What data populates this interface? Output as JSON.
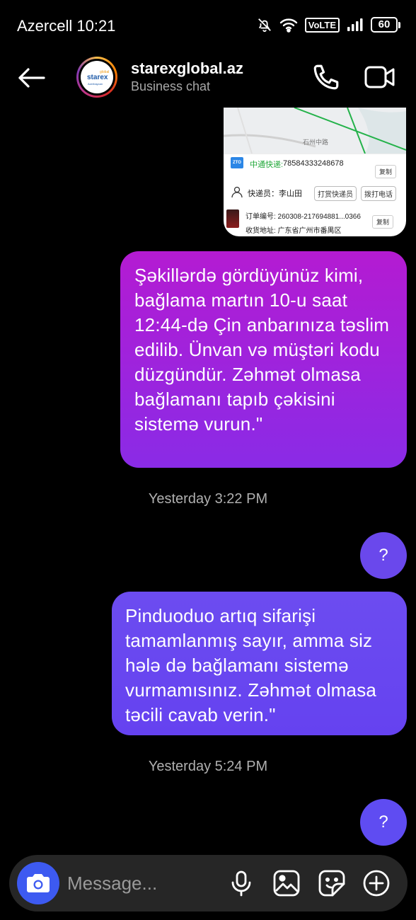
{
  "status_bar": {
    "carrier_time": "Azercell 10:21",
    "volte": "VoLTE",
    "battery": "60"
  },
  "header": {
    "name": "starexglobal.az",
    "subtitle": "Business chat",
    "avatar_logo": {
      "global": "global",
      "brand": "starex",
      "country": "Azerbaycan"
    }
  },
  "image_message": {
    "map_label": "石州中路",
    "courier_label": "中通快递:",
    "tracking_number": "78584333248678",
    "copy": "复制",
    "courier_person": "快递员：李山田",
    "tip_button": "打赏快递员",
    "call_button": "拨打电话",
    "order_number": "订单编号: 260308-217694881...0366",
    "address": "收货地址: 广东省广州市番禺区"
  },
  "messages": [
    {
      "type": "sent",
      "text": "Şəkillərdə gördüyünüz kimi, bağlama martın 10-u saat 12:44-də Çin anbarınıza təslim edilib. Ünvan və müştəri kodu düzgündür. Zəhmət olmasa bağlamanı tapıb çəkisini sistemə vurun.\""
    },
    {
      "type": "timestamp",
      "text": "Yesterday 3:22 PM"
    },
    {
      "type": "sent",
      "text": "?"
    },
    {
      "type": "sent",
      "text": "Pinduoduo artıq sifarişi tamamlanmış sayır, amma siz hələ də bağlamanı sistemə vurmamısınız. Zəhmət olmasa təcili cavab verin.\""
    },
    {
      "type": "timestamp",
      "text": "Yesterday 5:24 PM"
    },
    {
      "type": "sent",
      "text": "?"
    }
  ],
  "composer": {
    "placeholder": "Message..."
  },
  "colors": {
    "bubble_gradient_top": "#b41bd2",
    "bubble_gradient_bottom": "#8a2be6",
    "bubble_blue": "#6542f0",
    "camera_button": "#3d5af1",
    "background": "#000000"
  },
  "icons": [
    "back-arrow-icon",
    "phone-icon",
    "video-camera-icon",
    "camera-icon",
    "microphone-icon",
    "gallery-icon",
    "sticker-icon",
    "plus-icon",
    "bell-off-icon",
    "wifi-icon",
    "signal-icon",
    "battery-icon"
  ]
}
